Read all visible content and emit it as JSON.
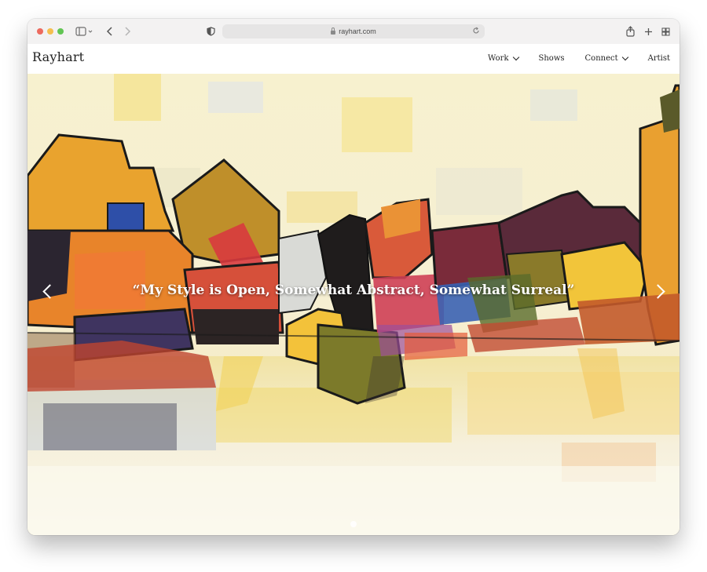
{
  "browser": {
    "url": "rayhart.com",
    "icons": [
      "sidebar-icon",
      "back-icon",
      "forward-icon",
      "shield-icon",
      "lock-icon",
      "reload-icon",
      "share-icon",
      "new-tab-icon",
      "tab-overview-icon"
    ],
    "traffic_light_colors": [
      "#ed6a5e",
      "#f5bf4f",
      "#62c554"
    ]
  },
  "site": {
    "logo": "Rayhart",
    "nav": {
      "work": "Work",
      "shows": "Shows",
      "connect": "Connect",
      "artist": "Artist"
    }
  },
  "hero": {
    "quote": "“My Style is Open, Somewhat Abstract, Somewhat Surreal”",
    "slides": 1,
    "active_slide": 1
  }
}
